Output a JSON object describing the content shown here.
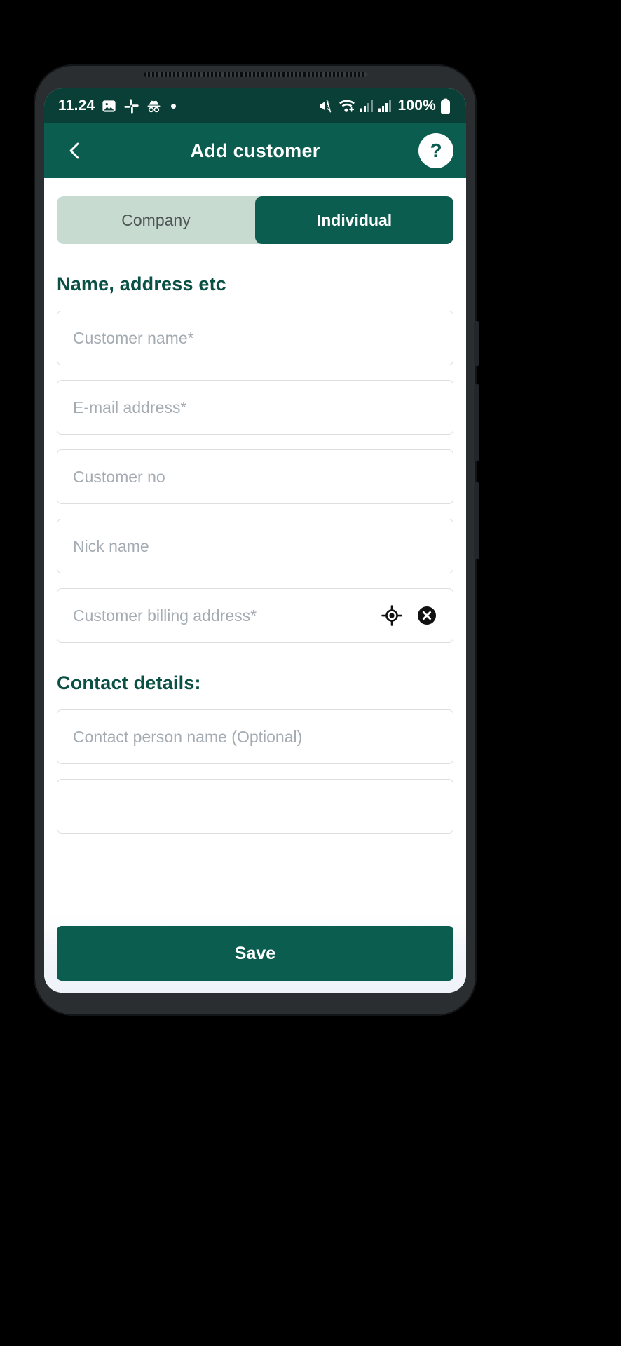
{
  "status_bar": {
    "time": "11.24",
    "battery_percent": "100%",
    "icons": [
      "gallery-icon",
      "slack-icon",
      "incognito-icon",
      "dot-indicator",
      "mute-icon",
      "wifi-icon",
      "signal-1-icon",
      "signal-2-icon",
      "battery-icon"
    ],
    "background": "#0a3f37"
  },
  "app_bar": {
    "title": "Add customer",
    "back_icon": "chevron-left-icon",
    "help_label": "?",
    "background": "#0b5d50"
  },
  "segmented_control": {
    "options": [
      {
        "label": "Company",
        "selected": false
      },
      {
        "label": "Individual",
        "selected": true
      }
    ],
    "track_color": "#c8dbd1",
    "active_color": "#0b5d50"
  },
  "sections": [
    {
      "title": "Name, address etc",
      "fields": [
        {
          "placeholder": "Customer name*",
          "value": "",
          "icons": []
        },
        {
          "placeholder": "E-mail address*",
          "value": "",
          "icons": []
        },
        {
          "placeholder": "Customer no",
          "value": "",
          "icons": []
        },
        {
          "placeholder": "Nick name",
          "value": "",
          "icons": []
        },
        {
          "placeholder": "Customer billing address*",
          "value": "",
          "icons": [
            "gps-crosshair-icon",
            "clear-circle-icon"
          ]
        }
      ]
    },
    {
      "title": "Contact details:",
      "fields": [
        {
          "placeholder": "Contact person name (Optional)",
          "value": "",
          "icons": []
        },
        {
          "placeholder": "",
          "value": "",
          "icons": []
        }
      ]
    }
  ],
  "save_bar": {
    "save_label": "Save"
  },
  "nav_bar": {
    "items": [
      "recents-icon",
      "home-icon",
      "back-icon"
    ]
  },
  "colors": {
    "brand_dark": "#0a3f37",
    "brand": "#0b5d50",
    "heading": "#0b5044",
    "placeholder": "#a4abb2",
    "field_border": "#dcdfe2"
  }
}
